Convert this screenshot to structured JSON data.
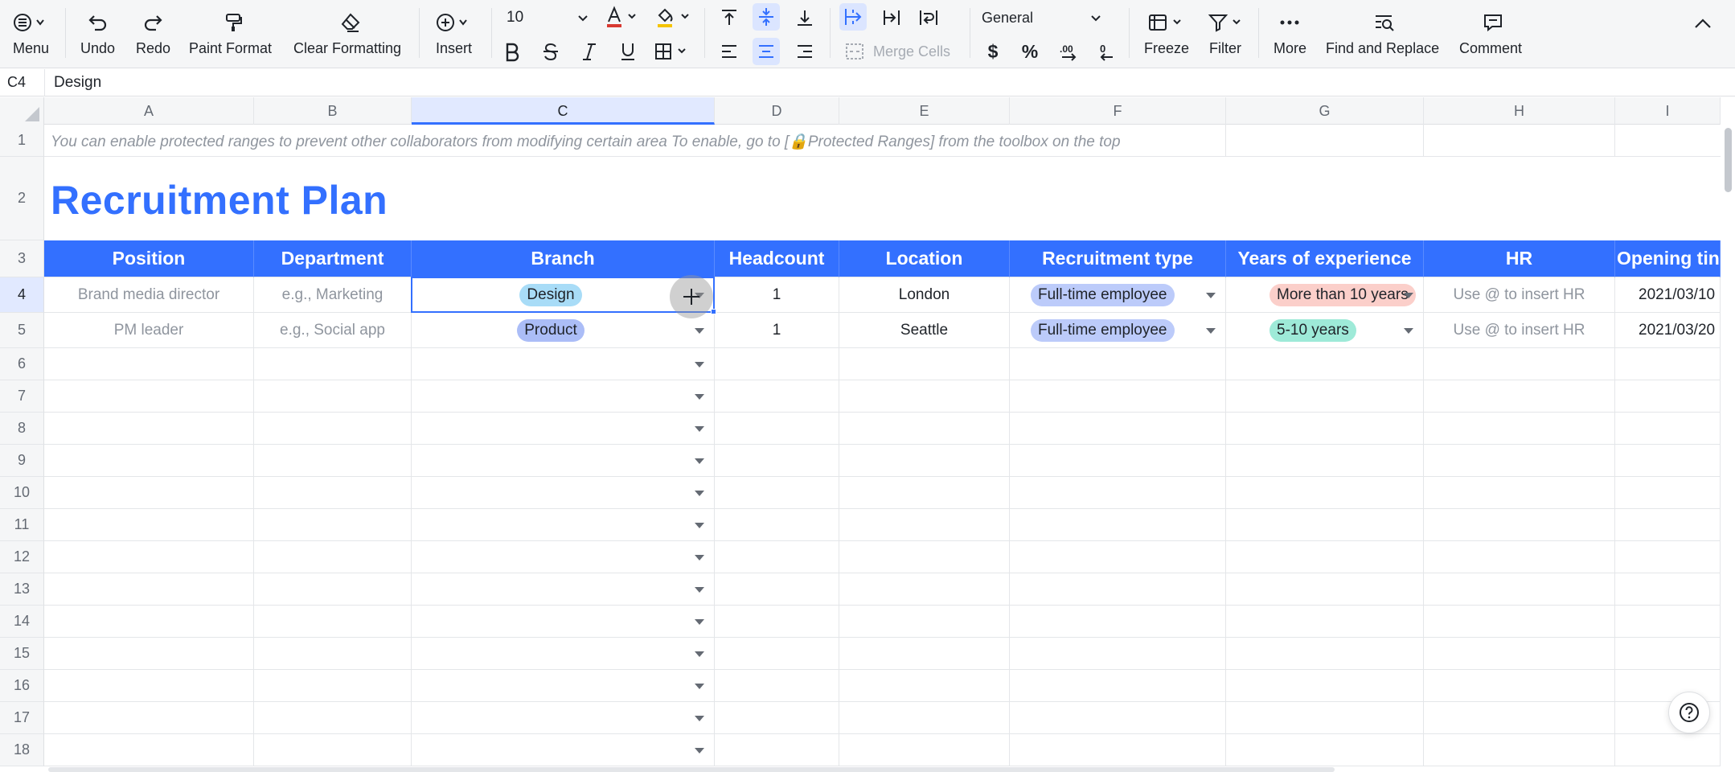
{
  "toolbar": {
    "menu": "Menu",
    "undo": "Undo",
    "redo": "Redo",
    "paint_format": "Paint Format",
    "clear_formatting": "Clear Formatting",
    "insert": "Insert",
    "font_size": "10",
    "merge_cells": "Merge Cells",
    "number_format": "General",
    "currency": "$",
    "percent": "%",
    "decimal_increase": ".00",
    "freeze": "Freeze",
    "filter": "Filter",
    "more": "More",
    "find_replace": "Find and Replace",
    "comment": "Comment",
    "font_color": "#d83931",
    "fill_color": "#f5c400"
  },
  "formula_bar": {
    "cell_ref": "C4",
    "value": "Design"
  },
  "columns": [
    "A",
    "B",
    "C",
    "D",
    "E",
    "F",
    "G",
    "H",
    "I"
  ],
  "rows": [
    "1",
    "2",
    "3",
    "4",
    "5",
    "6",
    "7",
    "8",
    "9",
    "10",
    "11",
    "12",
    "13",
    "14",
    "15",
    "16",
    "17",
    "18"
  ],
  "sheet": {
    "note": "You can enable protected ranges to prevent other collaborators from modifying certain area To enable, go to [🔒Protected Ranges] from the toolbox on the top",
    "title": "Recruitment Plan",
    "headers": [
      "Position",
      "Department",
      "Branch",
      "Headcount",
      "Location",
      "Recruitment type",
      "Years of experience",
      "HR",
      "Opening tin"
    ],
    "data_rows": [
      {
        "position": "Brand media director",
        "department": "e.g., Marketing",
        "branch": "Design",
        "headcount": "1",
        "location": "London",
        "type": "Full-time employee",
        "experience": "More than 10 years",
        "hr": "Use @ to insert HR",
        "opening": "2021/03/10"
      },
      {
        "position": "PM leader",
        "department": "e.g., Social app",
        "branch": "Product",
        "headcount": "1",
        "location": "Seattle",
        "type": "Full-time employee",
        "experience": "5-10 years",
        "hr": "Use @ to insert HR",
        "opening": "2021/03/20"
      }
    ]
  },
  "colors": {
    "accent": "#3370ff",
    "tag_design": "#a8dcf7",
    "tag_product": "#abbdf7",
    "tag_fulltime": "#bccbfa",
    "tag_10plus": "#fbcfca",
    "tag_5to10": "#9eead8"
  }
}
